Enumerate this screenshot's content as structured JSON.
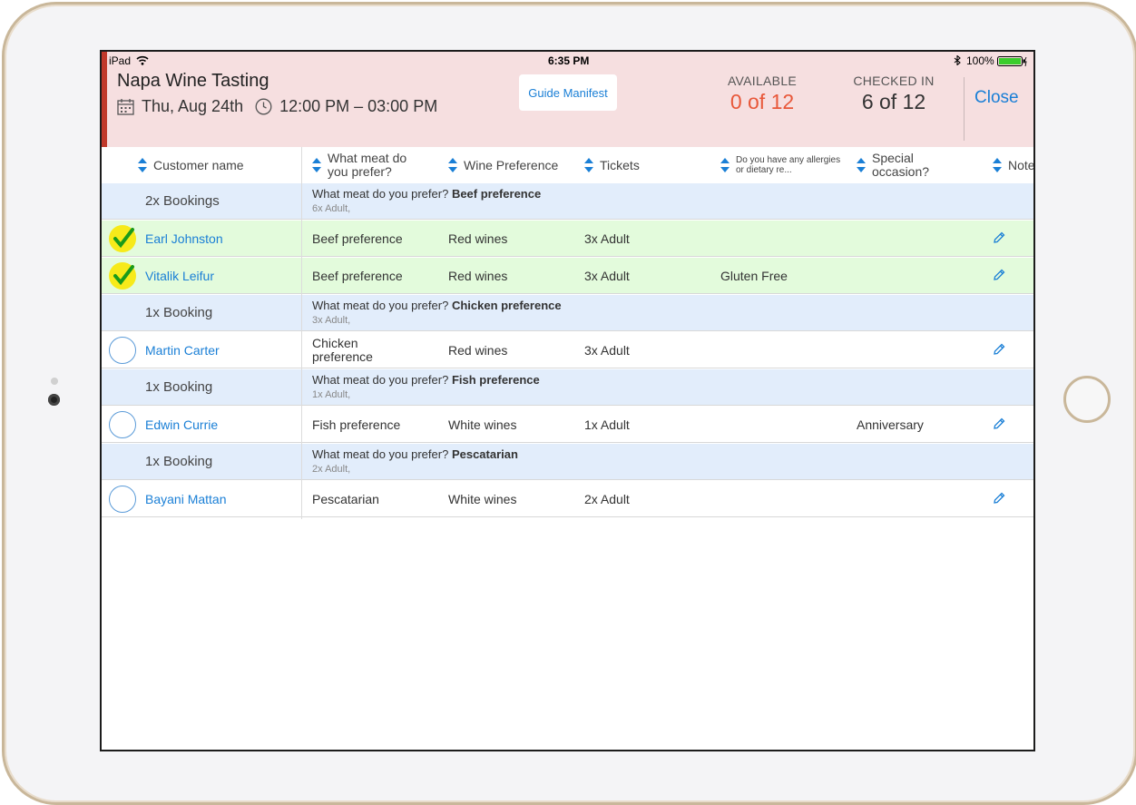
{
  "status_bar": {
    "device": "iPad",
    "time": "6:35 PM",
    "battery": "100%"
  },
  "header": {
    "title": "Napa Wine Tasting",
    "date": "Thu, Aug 24th",
    "time_range": "12:00 PM – 03:00 PM",
    "guide_button": "Guide Manifest",
    "available_label": "AVAILABLE",
    "available_value": "0 of 12",
    "checked_in_label": "CHECKED IN",
    "checked_in_value": "6 of 12",
    "close_button": "Close",
    "colors": {
      "available": "#e8583a",
      "accent": "#1a7fd6",
      "header_bg": "#f6dfe0"
    }
  },
  "columns": [
    {
      "label": "Customer name"
    },
    {
      "label": "What meat do you prefer?"
    },
    {
      "label": "Wine Preference"
    },
    {
      "label": "Tickets"
    },
    {
      "label": "Do you have any allergies or dietary re..."
    },
    {
      "label": "Special occasion?"
    },
    {
      "label": "Note"
    }
  ],
  "groups": [
    {
      "label": "2x Bookings",
      "question": "What meat do you prefer?",
      "answer": "Beef preference",
      "sub": "6x Adult,",
      "rows": [
        {
          "name": "Earl Johnston",
          "meat": "Beef preference",
          "wine": "Red wines",
          "tickets": "3x Adult",
          "allergy": "",
          "occasion": "",
          "checked": true
        },
        {
          "name": "Vitalik Leifur",
          "meat": "Beef preference",
          "wine": "Red wines",
          "tickets": "3x Adult",
          "allergy": "Gluten Free",
          "occasion": "",
          "checked": true
        }
      ]
    },
    {
      "label": "1x Booking",
      "question": "What meat do you prefer?",
      "answer": "Chicken preference",
      "sub": "3x Adult,",
      "rows": [
        {
          "name": "Martin Carter",
          "meat": "Chicken preference",
          "wine": "Red wines",
          "tickets": "3x Adult",
          "allergy": "",
          "occasion": "",
          "checked": false
        }
      ]
    },
    {
      "label": "1x Booking",
      "question": "What meat do you prefer?",
      "answer": "Fish preference",
      "sub": "1x Adult,",
      "rows": [
        {
          "name": "Edwin Currie",
          "meat": "Fish preference",
          "wine": "White wines",
          "tickets": "1x Adult",
          "allergy": "",
          "occasion": "Anniversary",
          "checked": false
        }
      ]
    },
    {
      "label": "1x Booking",
      "question": "What meat do you prefer?",
      "answer": "Pescatarian",
      "sub": "2x Adult,",
      "rows": [
        {
          "name": "Bayani Mattan",
          "meat": "Pescatarian",
          "wine": "White wines",
          "tickets": "2x Adult",
          "allergy": "",
          "occasion": "",
          "checked": false
        }
      ]
    }
  ]
}
